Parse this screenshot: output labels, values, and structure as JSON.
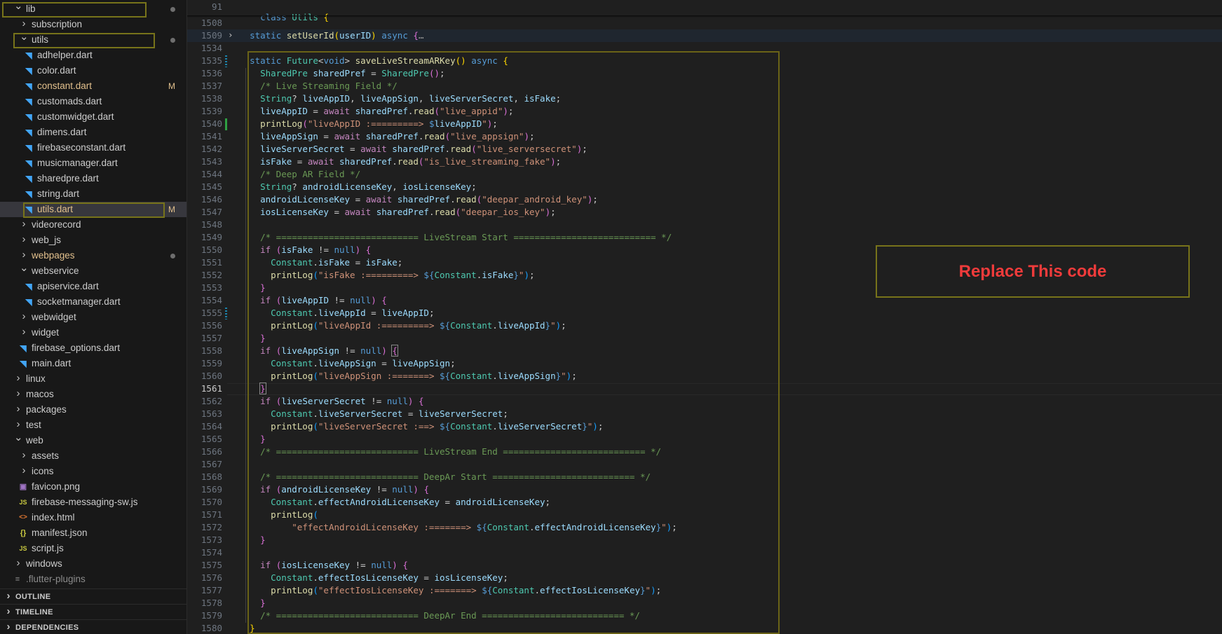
{
  "sidebar": {
    "items": [
      {
        "label": "lib",
        "type": "folder",
        "open": true,
        "indent": 1,
        "icon": "chevron-down-icon",
        "dot": true
      },
      {
        "label": "subscription",
        "type": "folder",
        "open": false,
        "indent": 2,
        "icon": "chevron-right-icon"
      },
      {
        "label": "utils",
        "type": "folder",
        "open": true,
        "indent": 2,
        "icon": "chevron-down-icon",
        "dot": true
      },
      {
        "label": "adhelper.dart",
        "type": "file",
        "indent": 3,
        "icon": "dart-file-icon"
      },
      {
        "label": "color.dart",
        "type": "file",
        "indent": 3,
        "icon": "dart-file-icon"
      },
      {
        "label": "constant.dart",
        "type": "file",
        "indent": 3,
        "icon": "dart-file-icon",
        "badge": "M",
        "modified": true
      },
      {
        "label": "customads.dart",
        "type": "file",
        "indent": 3,
        "icon": "dart-file-icon"
      },
      {
        "label": "customwidget.dart",
        "type": "file",
        "indent": 3,
        "icon": "dart-file-icon"
      },
      {
        "label": "dimens.dart",
        "type": "file",
        "indent": 3,
        "icon": "dart-file-icon"
      },
      {
        "label": "firebaseconstant.dart",
        "type": "file",
        "indent": 3,
        "icon": "dart-file-icon"
      },
      {
        "label": "musicmanager.dart",
        "type": "file",
        "indent": 3,
        "icon": "dart-file-icon"
      },
      {
        "label": "sharedpre.dart",
        "type": "file",
        "indent": 3,
        "icon": "dart-file-icon"
      },
      {
        "label": "string.dart",
        "type": "file",
        "indent": 3,
        "icon": "dart-file-icon"
      },
      {
        "label": "utils.dart",
        "type": "file",
        "indent": 3,
        "icon": "dart-file-icon",
        "badge": "M",
        "modified": true,
        "selected": true
      },
      {
        "label": "videorecord",
        "type": "folder",
        "open": false,
        "indent": 2,
        "icon": "chevron-right-icon"
      },
      {
        "label": "web_js",
        "type": "folder",
        "open": false,
        "indent": 2,
        "icon": "chevron-right-icon"
      },
      {
        "label": "webpages",
        "type": "folder",
        "open": false,
        "indent": 2,
        "icon": "chevron-right-icon",
        "dot": true,
        "modified": true
      },
      {
        "label": "webservice",
        "type": "folder",
        "open": true,
        "indent": 2,
        "icon": "chevron-down-icon"
      },
      {
        "label": "apiservice.dart",
        "type": "file",
        "indent": 3,
        "icon": "dart-file-icon"
      },
      {
        "label": "socketmanager.dart",
        "type": "file",
        "indent": 3,
        "icon": "dart-file-icon"
      },
      {
        "label": "webwidget",
        "type": "folder",
        "open": false,
        "indent": 2,
        "icon": "chevron-right-icon"
      },
      {
        "label": "widget",
        "type": "folder",
        "open": false,
        "indent": 2,
        "icon": "chevron-right-icon"
      },
      {
        "label": "firebase_options.dart",
        "type": "file",
        "indent": 2,
        "icon": "dart-file-icon"
      },
      {
        "label": "main.dart",
        "type": "file",
        "indent": 2,
        "icon": "dart-file-icon"
      },
      {
        "label": "linux",
        "type": "folder",
        "open": false,
        "indent": 1,
        "icon": "chevron-right-icon"
      },
      {
        "label": "macos",
        "type": "folder",
        "open": false,
        "indent": 1,
        "icon": "chevron-right-icon"
      },
      {
        "label": "packages",
        "type": "folder",
        "open": false,
        "indent": 1,
        "icon": "chevron-right-icon"
      },
      {
        "label": "test",
        "type": "folder",
        "open": false,
        "indent": 1,
        "icon": "chevron-right-icon"
      },
      {
        "label": "web",
        "type": "folder",
        "open": true,
        "indent": 1,
        "icon": "chevron-down-icon"
      },
      {
        "label": "assets",
        "type": "folder",
        "open": false,
        "indent": 2,
        "icon": "chevron-right-icon"
      },
      {
        "label": "icons",
        "type": "folder",
        "open": false,
        "indent": 2,
        "icon": "chevron-right-icon"
      },
      {
        "label": "favicon.png",
        "type": "file",
        "indent": 2,
        "icon": "image-file-icon"
      },
      {
        "label": "firebase-messaging-sw.js",
        "type": "file",
        "indent": 2,
        "icon": "js-file-icon"
      },
      {
        "label": "index.html",
        "type": "file",
        "indent": 2,
        "icon": "html-file-icon"
      },
      {
        "label": "manifest.json",
        "type": "file",
        "indent": 2,
        "icon": "json-file-icon"
      },
      {
        "label": "script.js",
        "type": "file",
        "indent": 2,
        "icon": "js-file-icon"
      },
      {
        "label": "windows",
        "type": "folder",
        "open": false,
        "indent": 1,
        "icon": "chevron-right-icon"
      },
      {
        "label": ".flutter-plugins",
        "type": "file",
        "indent": 1,
        "icon": "config-file-icon",
        "dim": true
      }
    ],
    "panels": [
      "OUTLINE",
      "TIMELINE",
      "DEPENDENCIES"
    ]
  },
  "editor": {
    "sticky": {
      "line": "91",
      "text": "class Utils {"
    },
    "active_line": "1561",
    "lines": [
      {
        "n": "1508",
        "html": ""
      },
      {
        "n": "1509",
        "html": "  <span class=\"k\">static</span> <span class=\"f\">setUserId</span><span class=\"p\">(</span><span class=\"v\">userID</span><span class=\"p\">)</span> <span class=\"k\">async</span> <span class=\"pp\">{</span><span style=\"color:#9d9d9d\">…</span>",
        "fold": true
      },
      {
        "n": "1534",
        "html": ""
      },
      {
        "n": "1535",
        "html": "  <span class=\"k\">static</span> <span class=\"t\">Future</span>&lt;<span class=\"k\">void</span>&gt; <span class=\"f\">saveLiveStreamARKey</span><span class=\"p\">()</span> <span class=\"k\">async</span> <span class=\"p\">{</span>",
        "mark": "mod"
      },
      {
        "n": "1536",
        "html": "    <span class=\"t\">SharedPre</span> <span class=\"v\">sharedPref</span> = <span class=\"t\">SharedPre</span><span class=\"pp\">()</span>;"
      },
      {
        "n": "1537",
        "html": "    <span class=\"c\">/* Live Streaming Field */</span>"
      },
      {
        "n": "1538",
        "html": "    <span class=\"t\">String</span>? <span class=\"v\">liveAppID</span>, <span class=\"v\">liveAppSign</span>, <span class=\"v\">liveServerSecret</span>, <span class=\"v\">isFake</span>;"
      },
      {
        "n": "1539",
        "html": "    <span class=\"v\">liveAppID</span> = <span class=\"kc\">await</span> <span class=\"v\">sharedPref</span>.<span class=\"f\">read</span><span class=\"pp\">(</span><span class=\"s\">\"live_appid\"</span><span class=\"pp\">)</span>;"
      },
      {
        "n": "1540",
        "html": "    <span class=\"f\">printLog</span><span class=\"pp\">(</span><span class=\"s\">\"liveAppID :=========&gt; </span><span class=\"k\">$</span><span class=\"v\">liveAppID</span><span class=\"s\">\"</span><span class=\"pp\">)</span>;",
        "mark": "add"
      },
      {
        "n": "1541",
        "html": "    <span class=\"v\">liveAppSign</span> = <span class=\"kc\">await</span> <span class=\"v\">sharedPref</span>.<span class=\"f\">read</span><span class=\"pp\">(</span><span class=\"s\">\"live_appsign\"</span><span class=\"pp\">)</span>;"
      },
      {
        "n": "1542",
        "html": "    <span class=\"v\">liveServerSecret</span> = <span class=\"kc\">await</span> <span class=\"v\">sharedPref</span>.<span class=\"f\">read</span><span class=\"pp\">(</span><span class=\"s\">\"live_serversecret\"</span><span class=\"pp\">)</span>;"
      },
      {
        "n": "1543",
        "html": "    <span class=\"v\">isFake</span> = <span class=\"kc\">await</span> <span class=\"v\">sharedPref</span>.<span class=\"f\">read</span><span class=\"pp\">(</span><span class=\"s\">\"is_live_streaming_fake\"</span><span class=\"pp\">)</span>;"
      },
      {
        "n": "1544",
        "html": "    <span class=\"c\">/* Deep AR Field */</span>"
      },
      {
        "n": "1545",
        "html": "    <span class=\"t\">String</span>? <span class=\"v\">androidLicenseKey</span>, <span class=\"v\">iosLicenseKey</span>;"
      },
      {
        "n": "1546",
        "html": "    <span class=\"v\">androidLicenseKey</span> = <span class=\"kc\">await</span> <span class=\"v\">sharedPref</span>.<span class=\"f\">read</span><span class=\"pp\">(</span><span class=\"s\">\"deepar_android_key\"</span><span class=\"pp\">)</span>;"
      },
      {
        "n": "1547",
        "html": "    <span class=\"v\">iosLicenseKey</span> = <span class=\"kc\">await</span> <span class=\"v\">sharedPref</span>.<span class=\"f\">read</span><span class=\"pp\">(</span><span class=\"s\">\"deepar_ios_key\"</span><span class=\"pp\">)</span>;"
      },
      {
        "n": "1548",
        "html": ""
      },
      {
        "n": "1549",
        "html": "    <span class=\"c\">/* =========================== LiveStream Start =========================== */</span>"
      },
      {
        "n": "1550",
        "html": "    <span class=\"kc\">if</span> <span class=\"pp\">(</span><span class=\"v\">isFake</span> != <span class=\"k\">null</span><span class=\"pp\">)</span> <span class=\"pp\">{</span>"
      },
      {
        "n": "1551",
        "html": "      <span class=\"t\">Constant</span>.<span class=\"v\">isFake</span> = <span class=\"v\">isFake</span>;"
      },
      {
        "n": "1552",
        "html": "      <span class=\"f\">printLog</span><span class=\"pb\">(</span><span class=\"s\">\"isFake :=========&gt; </span><span class=\"k\">${</span><span class=\"t\">Constant</span>.<span class=\"v\">isFake</span><span class=\"k\">}</span><span class=\"s\">\"</span><span class=\"pb\">)</span>;"
      },
      {
        "n": "1553",
        "html": "    <span class=\"pp\">}</span>"
      },
      {
        "n": "1554",
        "html": "    <span class=\"kc\">if</span> <span class=\"pp\">(</span><span class=\"v\">liveAppID</span> != <span class=\"k\">null</span><span class=\"pp\">)</span> <span class=\"pp\">{</span>"
      },
      {
        "n": "1555",
        "html": "      <span class=\"t\">Constant</span>.<span class=\"v\">liveAppId</span> = <span class=\"v\">liveAppID</span>;",
        "mark": "mod"
      },
      {
        "n": "1556",
        "html": "      <span class=\"f\">printLog</span><span class=\"pb\">(</span><span class=\"s\">\"liveAppId :=========&gt; </span><span class=\"k\">${</span><span class=\"t\">Constant</span>.<span class=\"v\">liveAppId</span><span class=\"k\">}</span><span class=\"s\">\"</span><span class=\"pb\">)</span>;"
      },
      {
        "n": "1557",
        "html": "    <span class=\"pp\">}</span>"
      },
      {
        "n": "1558",
        "html": "    <span class=\"kc\">if</span> <span class=\"pp\">(</span><span class=\"v\">liveAppSign</span> != <span class=\"k\">null</span><span class=\"pp\">)</span> <span class=\"pp\" style=\"outline:1px solid #888\">{</span>"
      },
      {
        "n": "1559",
        "html": "      <span class=\"t\">Constant</span>.<span class=\"v\">liveAppSign</span> = <span class=\"v\">liveAppSign</span>;"
      },
      {
        "n": "1560",
        "html": "      <span class=\"f\">printLog</span><span class=\"pb\">(</span><span class=\"s\">\"liveAppSign :=======&gt; </span><span class=\"k\">${</span><span class=\"t\">Constant</span>.<span class=\"v\">liveAppSign</span><span class=\"k\">}</span><span class=\"s\">\"</span><span class=\"pb\">)</span>;"
      },
      {
        "n": "1561",
        "html": "    <span class=\"pp\" style=\"outline:1px solid #888\">}</span>"
      },
      {
        "n": "1562",
        "html": "    <span class=\"kc\">if</span> <span class=\"pp\">(</span><span class=\"v\">liveServerSecret</span> != <span class=\"k\">null</span><span class=\"pp\">)</span> <span class=\"pp\">{</span>"
      },
      {
        "n": "1563",
        "html": "      <span class=\"t\">Constant</span>.<span class=\"v\">liveServerSecret</span> = <span class=\"v\">liveServerSecret</span>;"
      },
      {
        "n": "1564",
        "html": "      <span class=\"f\">printLog</span><span class=\"pb\">(</span><span class=\"s\">\"liveServerSecret :==&gt; </span><span class=\"k\">${</span><span class=\"t\">Constant</span>.<span class=\"v\">liveServerSecret</span><span class=\"k\">}</span><span class=\"s\">\"</span><span class=\"pb\">)</span>;"
      },
      {
        "n": "1565",
        "html": "    <span class=\"pp\">}</span>"
      },
      {
        "n": "1566",
        "html": "    <span class=\"c\">/* =========================== LiveStream End =========================== */</span>"
      },
      {
        "n": "1567",
        "html": ""
      },
      {
        "n": "1568",
        "html": "    <span class=\"c\">/* =========================== DeepAr Start =========================== */</span>"
      },
      {
        "n": "1569",
        "html": "    <span class=\"kc\">if</span> <span class=\"pp\">(</span><span class=\"v\">androidLicenseKey</span> != <span class=\"k\">null</span><span class=\"pp\">)</span> <span class=\"pp\">{</span>"
      },
      {
        "n": "1570",
        "html": "      <span class=\"t\">Constant</span>.<span class=\"v\">effectAndroidLicenseKey</span> = <span class=\"v\">androidLicenseKey</span>;"
      },
      {
        "n": "1571",
        "html": "      <span class=\"f\">printLog</span><span class=\"pb\">(</span>"
      },
      {
        "n": "1572",
        "html": "          <span class=\"s\">\"effectAndroidLicenseKey :=======&gt; </span><span class=\"k\">${</span><span class=\"t\">Constant</span>.<span class=\"v\">effectAndroidLicenseKey</span><span class=\"k\">}</span><span class=\"s\">\"</span><span class=\"pb\">)</span>;"
      },
      {
        "n": "1573",
        "html": "    <span class=\"pp\">}</span>"
      },
      {
        "n": "1574",
        "html": ""
      },
      {
        "n": "1575",
        "html": "    <span class=\"kc\">if</span> <span class=\"pp\">(</span><span class=\"v\">iosLicenseKey</span> != <span class=\"k\">null</span><span class=\"pp\">)</span> <span class=\"pp\">{</span>"
      },
      {
        "n": "1576",
        "html": "      <span class=\"t\">Constant</span>.<span class=\"v\">effectIosLicenseKey</span> = <span class=\"v\">iosLicenseKey</span>;"
      },
      {
        "n": "1577",
        "html": "      <span class=\"f\">printLog</span><span class=\"pb\">(</span><span class=\"s\">\"effectIosLicenseKey :=======&gt; </span><span class=\"k\">${</span><span class=\"t\">Constant</span>.<span class=\"v\">effectIosLicenseKey</span><span class=\"k\">}</span><span class=\"s\">\"</span><span class=\"pb\">)</span>;"
      },
      {
        "n": "1578",
        "html": "    <span class=\"pp\">}</span>"
      },
      {
        "n": "1579",
        "html": "    <span class=\"c\">/* =========================== DeepAr End =========================== */</span>"
      },
      {
        "n": "1580",
        "html": "  <span class=\"p\">}</span>"
      }
    ]
  },
  "annotation": {
    "text": "Replace This code"
  },
  "colors": {
    "highlight_border": "#77731a",
    "annotation_text": "#ef3b3b",
    "gutter_added": "#2ea043",
    "gutter_modified": "#1b81a8"
  }
}
